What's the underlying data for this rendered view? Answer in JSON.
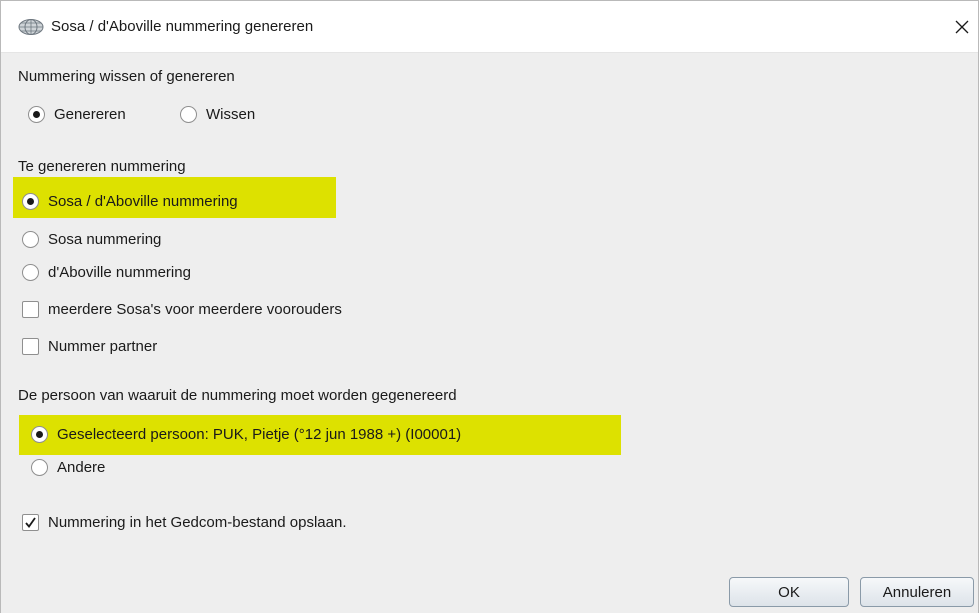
{
  "window": {
    "title": "Sosa / d'Aboville nummering genereren",
    "icon": "globe-icon"
  },
  "mode_group": {
    "label": "Nummering wissen of genereren",
    "options": [
      {
        "label": "Genereren",
        "selected": true
      },
      {
        "label": "Wissen",
        "selected": false
      }
    ]
  },
  "type_group": {
    "label": "Te genereren nummering",
    "options": [
      {
        "label": "Sosa / d'Aboville nummering",
        "selected": true,
        "highlighted": true
      },
      {
        "label": "Sosa nummering",
        "selected": false
      },
      {
        "label": "d'Aboville nummering",
        "selected": false
      }
    ],
    "checkboxes": [
      {
        "label": "meerdere Sosa's voor meerdere voorouders",
        "checked": false
      },
      {
        "label": "Nummer partner",
        "checked": false
      }
    ]
  },
  "person_group": {
    "label": "De persoon van waaruit de nummering moet worden gegenereerd",
    "options": [
      {
        "label": "Geselecteerd persoon: PUK, Pietje (°12 jun 1988 +) (I00001)",
        "selected": true,
        "highlighted": true
      },
      {
        "label": "Andere",
        "selected": false
      }
    ]
  },
  "save_option": {
    "label": "Nummering in het Gedcom-bestand opslaan.",
    "checked": true
  },
  "buttons": {
    "ok": "OK",
    "cancel": "Annuleren"
  },
  "colors": {
    "highlight": "#dde100",
    "dialog_bg": "#eeeeee",
    "titlebar_bg": "#ffffff"
  }
}
